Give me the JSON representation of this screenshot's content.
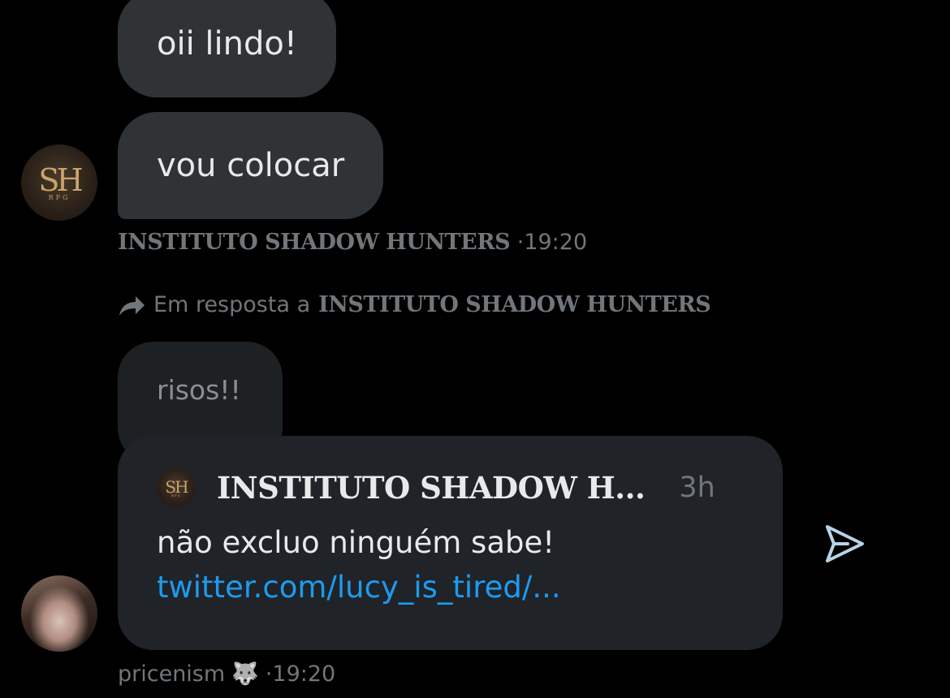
{
  "messages": [
    {
      "text": "oii lindo!"
    },
    {
      "text": "vou colocar"
    }
  ],
  "meta1": {
    "sender": "INSTITUTO SHADOW HUNTERS",
    "time": "·19:20"
  },
  "reply_context": {
    "prefix": "Em resposta a",
    "target": "INSTITUTO SHADOW HUNTERS"
  },
  "reply_bubble": {
    "text": "risos!!"
  },
  "quoted_tweet": {
    "author": "INSTITUTO SHADOW H...",
    "age": "3h",
    "text": "não excluo ninguém sabe!",
    "link": "twitter.com/lucy_is_tired/..."
  },
  "avatar_logo": {
    "letters": "SH",
    "sub": "RPG"
  },
  "meta2": {
    "sender": "pricenism",
    "emoji": "🐺",
    "time": "·19:20"
  },
  "icons": {
    "reply": "reply-arrow-icon",
    "send": "send-icon"
  },
  "colors": {
    "background": "#000000",
    "bubble": "#2f3336",
    "muted": "#71767b",
    "link": "#1d9bf0"
  }
}
